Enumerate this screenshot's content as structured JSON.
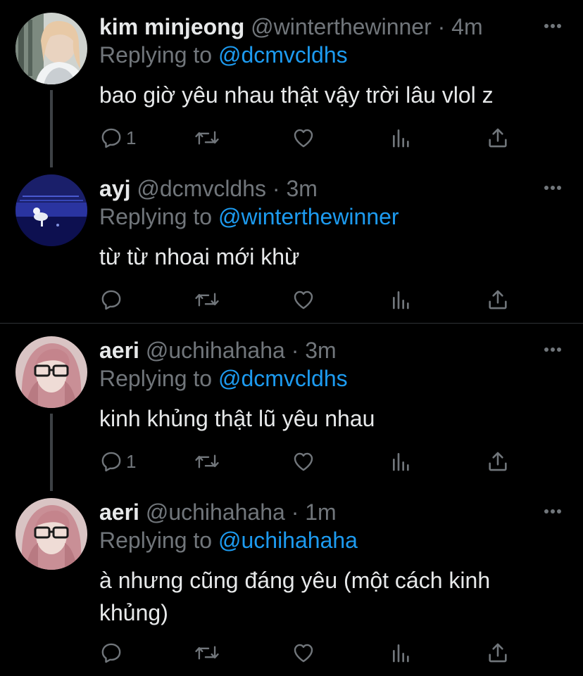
{
  "tweets": [
    {
      "name": "kim minjeong",
      "handle": "@winterthewinner",
      "dot": "·",
      "time": "4m",
      "replying_prefix": "Replying to",
      "replying_to": "@dcmvcldhs",
      "text": "bao giờ yêu nhau thật vậy trời lâu vlol z",
      "reply_count": "1",
      "avatar_icon": "user-avatar-photo"
    },
    {
      "name": "ayj",
      "handle": "@dcmvcldhs",
      "dot": "·",
      "time": "3m",
      "replying_prefix": "Replying to",
      "replying_to": "@winterthewinner",
      "text": "từ từ nhoai mới khừ",
      "reply_count": "",
      "avatar_icon": "user-avatar-photo"
    },
    {
      "name": "aeri",
      "handle": "@uchihahaha",
      "dot": "·",
      "time": "3m",
      "replying_prefix": "Replying to",
      "replying_to": "@dcmvcldhs",
      "text": "kinh khủng thật lũ yêu nhau",
      "reply_count": "1",
      "avatar_icon": "user-avatar-photo"
    },
    {
      "name": "aeri",
      "handle": "@uchihahaha",
      "dot": "·",
      "time": "1m",
      "replying_prefix": "Replying to",
      "replying_to": "@uchihahaha",
      "text": "à nhưng cũng đáng yêu (một cách kinh khủng)",
      "reply_count": "",
      "avatar_icon": "user-avatar-photo"
    }
  ],
  "icons": {
    "reply": "reply-icon",
    "retweet": "retweet-icon",
    "like": "like-icon",
    "analytics": "analytics-icon",
    "share": "share-icon",
    "more": "more-icon"
  },
  "colors": {
    "background": "#000000",
    "text": "#e7e9ea",
    "muted": "#71767b",
    "mention": "#1d9bf0",
    "thread_line": "#3d4145",
    "separator": "#2f3336"
  }
}
